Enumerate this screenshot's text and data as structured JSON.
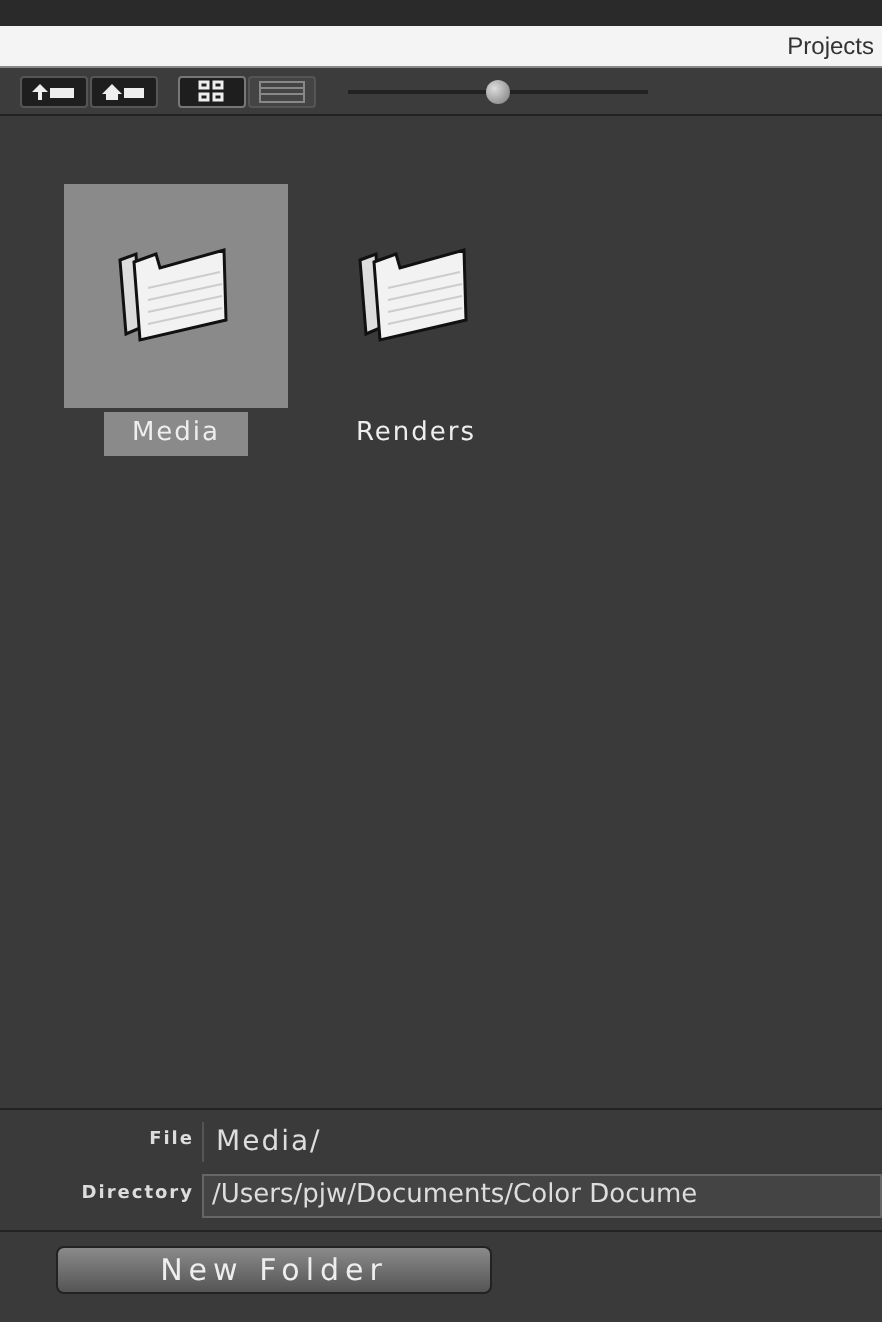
{
  "window": {
    "title": "Projects"
  },
  "nav_buttons": [
    {
      "kind": "up"
    },
    {
      "kind": "home"
    }
  ],
  "view_buttons": [
    {
      "kind": "icons",
      "selected": true
    },
    {
      "kind": "list",
      "selected": false
    }
  ],
  "zoom_slider": {
    "level": 0.5
  },
  "items": [
    {
      "name": "Media",
      "selected": true
    },
    {
      "name": "Renders",
      "selected": false
    }
  ],
  "file": {
    "label": "File",
    "value": "Media/"
  },
  "directory": {
    "label": "Directory",
    "value": "/Users/pjw/Documents/Color Docume"
  },
  "buttons": [
    "New Folder"
  ]
}
